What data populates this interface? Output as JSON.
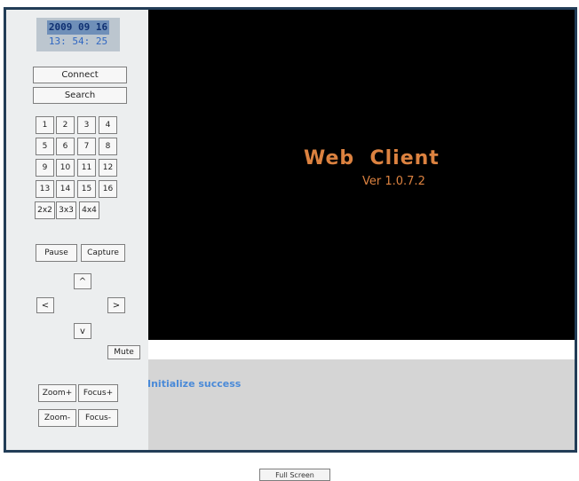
{
  "clock": {
    "date": "2009 09 16",
    "time": "13: 54: 25"
  },
  "controls": {
    "connect": "Connect",
    "search": "Search"
  },
  "channels": [
    "1",
    "2",
    "3",
    "4",
    "5",
    "6",
    "7",
    "8",
    "9",
    "10",
    "11",
    "12",
    "13",
    "14",
    "15",
    "16"
  ],
  "layouts": [
    "2x2",
    "3x3",
    "4x4"
  ],
  "actions": {
    "pause": "Pause",
    "capture": "Capture",
    "mute": "Mute"
  },
  "ptz": {
    "up": "^",
    "left": "<",
    "right": ">",
    "down": "v"
  },
  "lens": {
    "zoom_in": "Zoom+",
    "focus_in": "Focus+",
    "zoom_out": "Zoom-",
    "focus_out": "Focus-"
  },
  "video": {
    "title": "Web  Client",
    "version": "Ver 1.0.7.2"
  },
  "status": {
    "message": "Initialize success"
  },
  "footer": {
    "fullscreen": "Full Screen"
  }
}
